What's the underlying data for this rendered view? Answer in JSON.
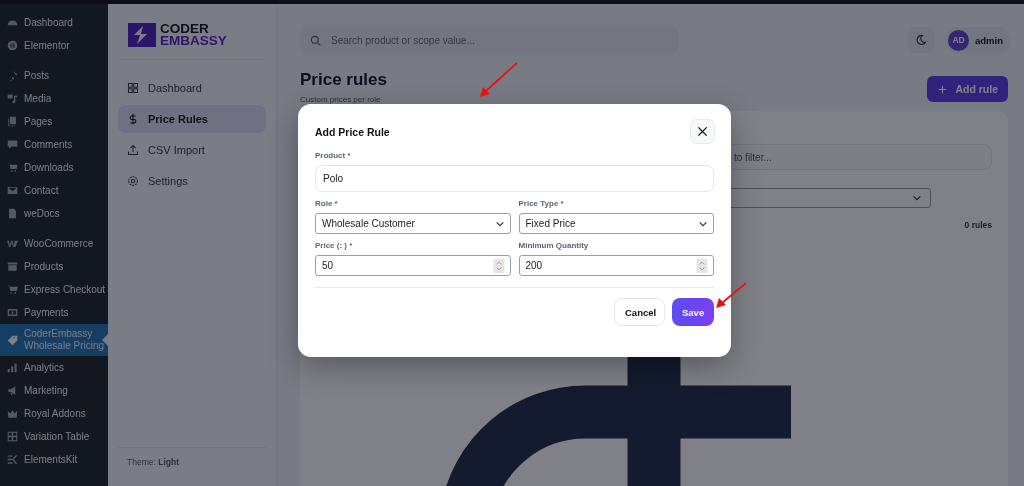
{
  "wp_menu": {
    "groups": [
      {
        "items": [
          {
            "label": "Dashboard",
            "selected": false
          },
          {
            "label": "Elementor",
            "selected": false
          }
        ]
      },
      {
        "items": [
          {
            "label": "Posts",
            "selected": false
          },
          {
            "label": "Media",
            "selected": false
          },
          {
            "label": "Pages",
            "selected": false
          },
          {
            "label": "Comments",
            "selected": false
          },
          {
            "label": "Downloads",
            "selected": false
          },
          {
            "label": "Contact",
            "selected": false
          },
          {
            "label": "weDocs",
            "selected": false
          }
        ]
      },
      {
        "items": [
          {
            "label": "WooCommerce",
            "selected": false
          },
          {
            "label": "Products",
            "selected": false
          },
          {
            "label": "Express Checkout",
            "selected": false
          },
          {
            "label": "Payments",
            "selected": false
          },
          {
            "label": "CoderEmbassy Wholesale Pricing",
            "selected": true
          },
          {
            "label": "Analytics",
            "selected": false
          },
          {
            "label": "Marketing",
            "selected": false
          },
          {
            "label": "Royal Addons",
            "selected": false
          },
          {
            "label": "Variation Table",
            "selected": false
          },
          {
            "label": "ElementsKit",
            "selected": false
          }
        ]
      }
    ]
  },
  "plugin_sidebar": {
    "logo": {
      "line_1": "CODER",
      "line_2": "EMBASSY"
    },
    "items": [
      {
        "label": "Dashboard",
        "selected": false
      },
      {
        "label": "Price Rules",
        "selected": true
      },
      {
        "label": "CSV Import",
        "selected": false
      },
      {
        "label": "Settings",
        "selected": false
      }
    ],
    "footer": "Theme: **Light**"
  },
  "header": {
    "search": {
      "placeholder": "Search product or scope value..."
    },
    "user": {
      "initials": "AD",
      "name": "admin"
    }
  },
  "page": {
    "title": "Price rules",
    "subtitle": "Custom prices per role",
    "add_button": "Add rule",
    "card": {
      "filter": {
        "placeholder": "to filter..."
      },
      "count": "0 rules"
    }
  },
  "modal": {
    "title": "Add Price Rule",
    "rows": [
      [
        {
          "kind": "text",
          "label": "Product *",
          "value": "Polo"
        }
      ],
      [
        {
          "kind": "select",
          "label": "Role *",
          "value": "Wholesale Customer"
        },
        {
          "kind": "select",
          "label": "Price Type *",
          "value": "Fixed Price"
        }
      ],
      [
        {
          "kind": "number",
          "label": "Price (: ) *",
          "value": "50"
        },
        {
          "kind": "number",
          "label": "Minimum Quantity",
          "value": "200"
        }
      ]
    ],
    "buttons": [
      {
        "kind": "secondary",
        "label": "Cancel"
      },
      {
        "kind": "primary",
        "label": "Save"
      }
    ]
  }
}
